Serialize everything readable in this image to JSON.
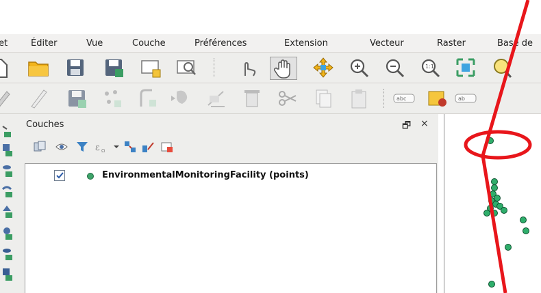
{
  "menubar": {
    "items": [
      "et",
      "Éditer",
      "Vue",
      "Couche",
      "Préférences",
      "Extension",
      "Vecteur",
      "Raster",
      "Base de"
    ]
  },
  "layers_panel": {
    "title": "Couches",
    "float_glyph": "🗗",
    "close_glyph": "×",
    "layers": [
      {
        "name": "EnvironmentalMonitoringFacility (points)",
        "checked": true,
        "symbol_color": "#3ea46a"
      }
    ]
  },
  "map": {
    "point_color": "#2fae6b",
    "annotation_color": "#e8161b"
  },
  "toolbar_icons": {
    "row1": [
      "new-project-icon",
      "open-folder-icon",
      "save-icon",
      "save-as-icon",
      "new-print-composer-icon",
      "composer-manager-icon",
      "touch-icon",
      "pan-hand-icon",
      "pan-to-selection-icon",
      "zoom-in-icon",
      "zoom-out-icon",
      "zoom-1-1-icon",
      "zoom-full-icon",
      "identify-icon"
    ],
    "row2": [
      "current-edits-icon",
      "toggle-edit-icon",
      "save-edits-icon",
      "add-feature-icon",
      "move-feature-icon",
      "node-tool-icon",
      "delete-selected-icon",
      "cut-features-icon",
      "copy-features-icon",
      "paste-features-icon",
      "label-abc-icon",
      "label-style-icon",
      "label-pin-icon"
    ]
  }
}
